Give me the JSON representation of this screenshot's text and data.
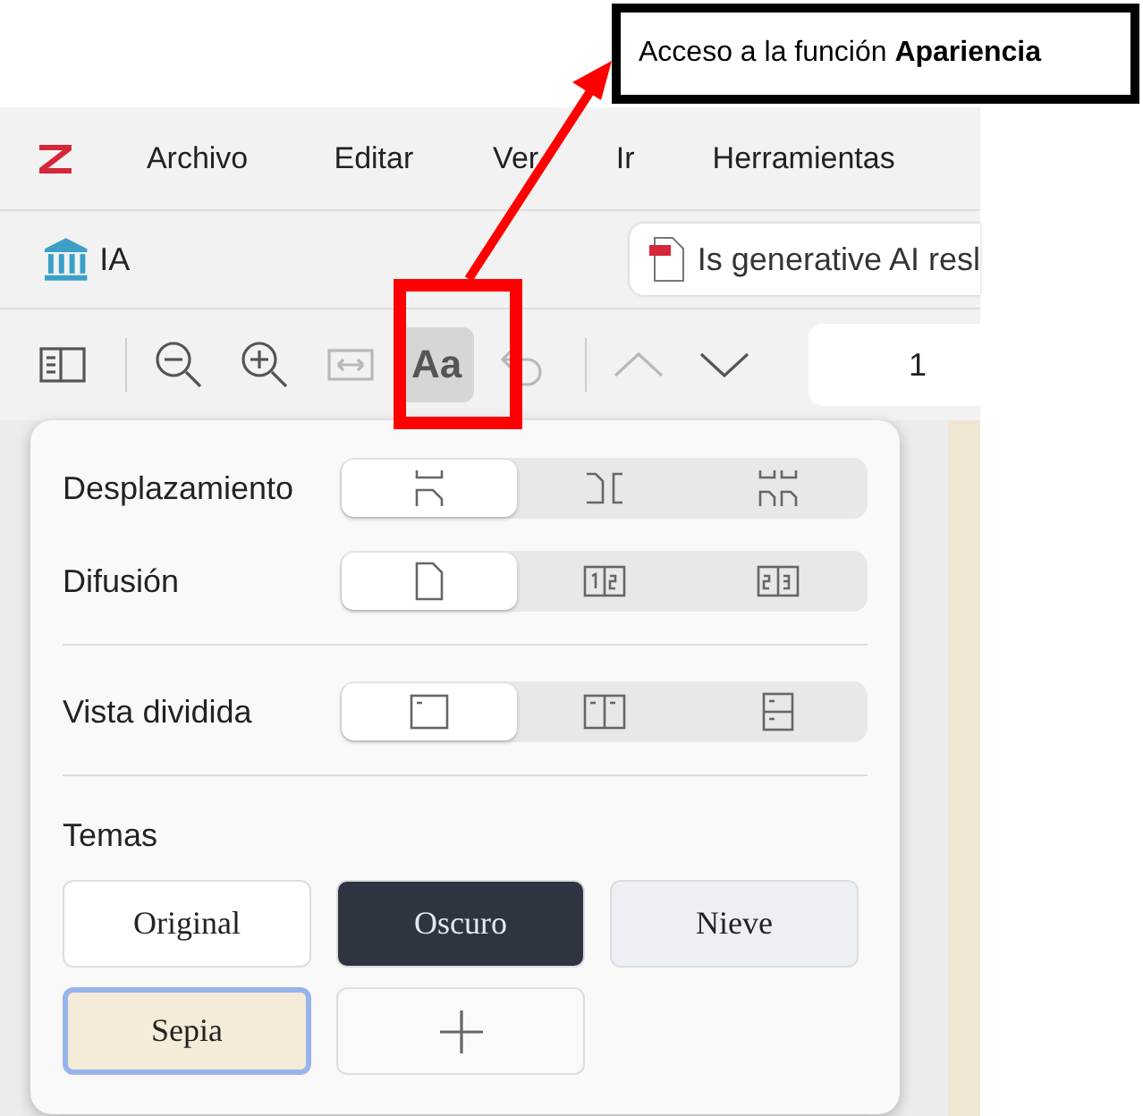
{
  "callout": {
    "text": "Acceso a la función **Apariencia**"
  },
  "menu": [
    {
      "label": "Archivo"
    },
    {
      "label": "Editar"
    },
    {
      "label": "Ver"
    },
    {
      "label": "Ir"
    },
    {
      "label": "Herramientas"
    }
  ],
  "collection": {
    "label": "IA"
  },
  "tab": {
    "title": "Is generative AI resl"
  },
  "toolbar": [
    {
      "kind": "sidebar",
      "disabled": false,
      "selected": false
    },
    {
      "kind": "divider"
    },
    {
      "kind": "zoom-out",
      "disabled": false,
      "selected": false
    },
    {
      "kind": "zoom-in",
      "disabled": false,
      "selected": false
    },
    {
      "kind": "fit",
      "disabled": true,
      "selected": false
    },
    {
      "kind": "appearance",
      "label": "Aa",
      "disabled": false,
      "selected": true
    },
    {
      "kind": "undo",
      "disabled": true,
      "selected": false
    },
    {
      "kind": "divider"
    },
    {
      "kind": "up",
      "disabled": true,
      "selected": false
    },
    {
      "kind": "down",
      "disabled": false,
      "selected": false
    }
  ],
  "page_field": {
    "value": "1"
  },
  "popup": {
    "sections": [
      [
        {
          "label": "Desplazamiento",
          "options": [
            {
              "kind": "vertical",
              "selected": true
            },
            {
              "kind": "horizontal",
              "selected": false
            },
            {
              "kind": "wrapped",
              "selected": false
            }
          ]
        },
        {
          "label": "Difusión",
          "options": [
            {
              "kind": "single",
              "selected": true
            },
            {
              "kind": "odd",
              "selected": false
            },
            {
              "kind": "even",
              "selected": false
            }
          ]
        }
      ],
      [
        {
          "label": "Vista dividida",
          "options": [
            {
              "kind": "none",
              "selected": true
            },
            {
              "kind": "split-vertical",
              "selected": false
            },
            {
              "kind": "split-horizontal",
              "selected": false
            }
          ]
        }
      ]
    ],
    "themes": {
      "heading": "Temas",
      "items": [
        {
          "label": "Original",
          "color": "#ffffff",
          "selected": false
        },
        {
          "label": "Oscuro",
          "color": "#2e3440",
          "selected": false
        },
        {
          "label": "Nieve",
          "color": "#eceff4",
          "selected": false
        },
        {
          "label": "Sepia",
          "color": "#f4ecd8",
          "selected": true
        }
      ]
    }
  }
}
